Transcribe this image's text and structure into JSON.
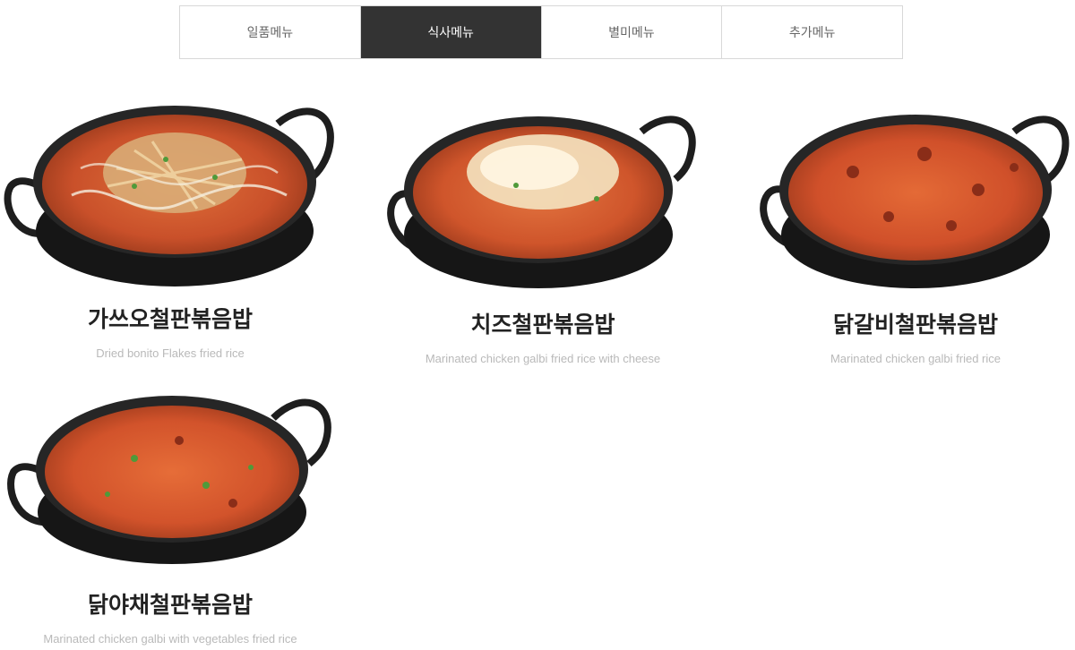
{
  "tabs": [
    {
      "label": "일품메뉴",
      "active": false
    },
    {
      "label": "식사메뉴",
      "active": true
    },
    {
      "label": "별미메뉴",
      "active": false
    },
    {
      "label": "추가메뉴",
      "active": false
    }
  ],
  "menu_items": [
    {
      "name": "가쓰오철판볶음밥",
      "description": "Dried bonito Flakes fried rice",
      "topping": "bonito"
    },
    {
      "name": "치즈철판볶음밥",
      "description": "Marinated chicken galbi fried rice with cheese",
      "topping": "cheese"
    },
    {
      "name": "닭갈비철판볶음밥",
      "description": "Marinated chicken galbi fried rice",
      "topping": "none"
    },
    {
      "name": "닭야채철판볶음밥",
      "description": "Marinated chicken galbi with vegetables fried rice",
      "topping": "none"
    }
  ],
  "colors": {
    "active_tab_bg": "#333333",
    "rice": "#d9582a",
    "pan": "#1e1e1e"
  }
}
